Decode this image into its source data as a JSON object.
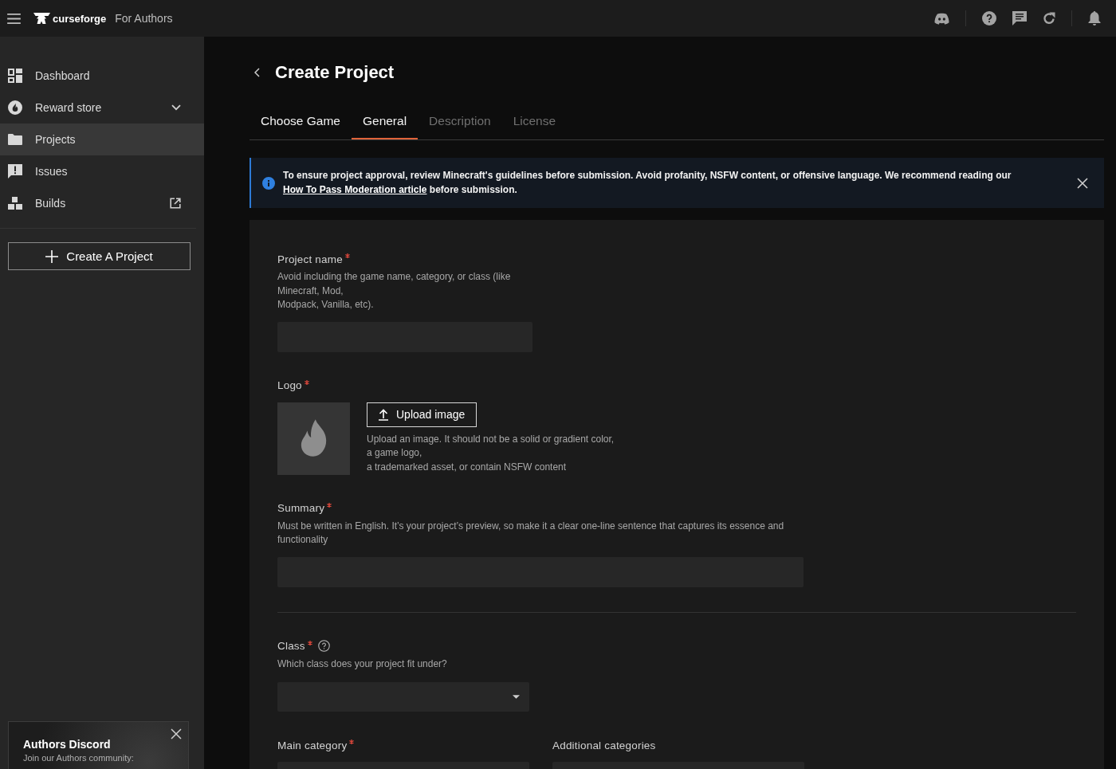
{
  "top_bar": {
    "brand": "curseforge",
    "section": "For Authors"
  },
  "sidebar": {
    "items": [
      {
        "label": "Dashboard",
        "kind": "page",
        "selected": false
      },
      {
        "label": "Reward store",
        "kind": "group",
        "selected": false
      },
      {
        "label": "Projects",
        "kind": "page",
        "selected": true
      },
      {
        "label": "Issues",
        "kind": "page",
        "selected": false
      },
      {
        "label": "Builds",
        "kind": "external",
        "selected": false
      }
    ],
    "create_button": "Create A Project",
    "promo": {
      "title": "Authors Discord",
      "text": "Join our Authors community:"
    }
  },
  "page": {
    "title": "Create Project",
    "tabs": [
      {
        "label": "Choose Game",
        "selected": false,
        "disabled": false
      },
      {
        "label": "General",
        "selected": true,
        "disabled": false
      },
      {
        "label": "Description",
        "selected": false,
        "disabled": true
      },
      {
        "label": "License",
        "selected": false,
        "disabled": true
      }
    ]
  },
  "notice": {
    "text": "To ensure project approval, review Minecraft's guidelines before submission. Avoid profanity, NSFW content, or offensive language. We recommend reading our ",
    "link": "How To Pass Moderation article",
    "text_after": " before submission."
  },
  "form": {
    "sections": [
      {
        "fields": [
          {
            "kind": "text",
            "label": "Project name",
            "required": true,
            "hint": "Avoid including the game name, category, or class (like\nMinecraft, Mod,\nModpack, Vanilla, etc)."
          },
          {
            "kind": "image",
            "label": "Logo",
            "required": true,
            "button": "Upload image",
            "hint": "Upload an image. It should not be a solid or gradient color,\na game logo,\na trademarked asset, or contain NSFW content"
          },
          {
            "kind": "long_text",
            "label": "Summary",
            "required": true,
            "hint": "Must be written in English. It’s your project’s preview, so make it a clear one-line sentence that captures its essence and\nfunctionality"
          }
        ]
      },
      {
        "fields": [
          {
            "kind": "select",
            "label": "Class",
            "required": true,
            "help": true,
            "hint": "Which class does your project fit under?"
          },
          {
            "kind": "row",
            "fields": [
              {
                "kind": "text",
                "label": "Main category",
                "required": true
              },
              {
                "kind": "text",
                "label": "Additional categories",
                "required": false
              }
            ]
          }
        ]
      }
    ]
  }
}
